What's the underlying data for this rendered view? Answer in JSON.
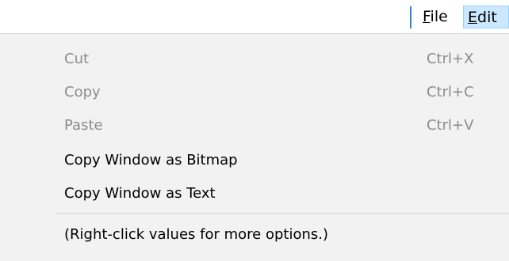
{
  "menubar": {
    "file": {
      "prefix": "",
      "mnemonic": "F",
      "rest": "ile"
    },
    "edit": {
      "prefix": "",
      "mnemonic": "E",
      "rest": "dit"
    }
  },
  "edit_menu": {
    "items": [
      {
        "label": "Cut",
        "shortcut": "Ctrl+X",
        "enabled": false
      },
      {
        "label": "Copy",
        "shortcut": "Ctrl+C",
        "enabled": false
      },
      {
        "label": "Paste",
        "shortcut": "Ctrl+V",
        "enabled": false
      },
      {
        "label": "Copy Window as Bitmap",
        "shortcut": "",
        "enabled": true
      },
      {
        "label": "Copy Window as Text",
        "shortcut": "",
        "enabled": true
      }
    ],
    "note": "(Right-click values for more options.)"
  },
  "colors": {
    "menu_background": "#f2f2f2",
    "disabled_text": "#8c8c8c",
    "active_menu_highlight": "#cce8ff",
    "active_menu_border": "#99d1ff",
    "menubar_separator": "#2e7fd6"
  }
}
